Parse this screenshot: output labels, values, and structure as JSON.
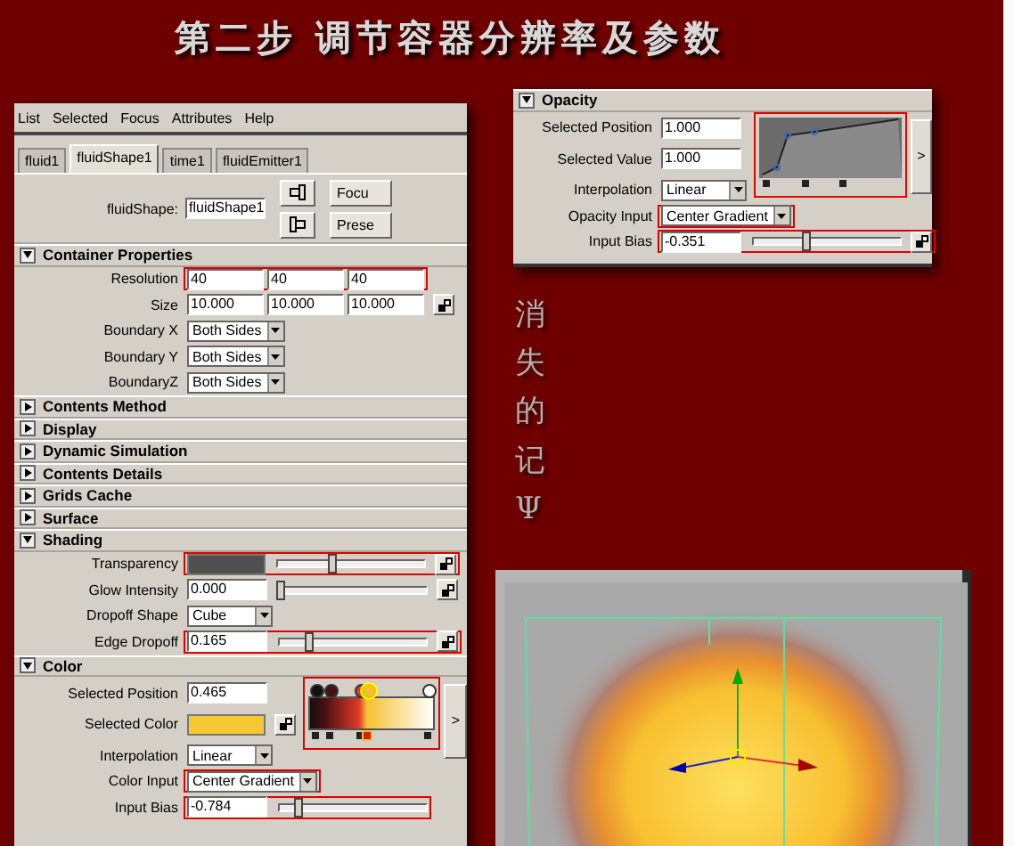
{
  "title": "第二步 调节容器分辨率及参数",
  "side_text": "消失的记Ψ",
  "attribute_editor": {
    "menu": [
      "List",
      "Selected",
      "Focus",
      "Attributes",
      "Help"
    ],
    "tabs": [
      {
        "label": "fluid1",
        "selected": false
      },
      {
        "label": "fluidShape1",
        "selected": true
      },
      {
        "label": "time1",
        "selected": false
      },
      {
        "label": "fluidEmitter1",
        "selected": false
      }
    ],
    "node": {
      "label": "fluidShape:",
      "value": "fluidShape1"
    },
    "buttons": [
      "Focu",
      "Prese"
    ],
    "sections": [
      {
        "title": "Container Properties",
        "expanded": true,
        "rows": [
          {
            "kind": "triple",
            "label": "Resolution",
            "values": [
              "40",
              "40",
              "40"
            ],
            "map_button": false,
            "highlighted": true
          },
          {
            "kind": "triple",
            "label": "Size",
            "values": [
              "10.000",
              "10.000",
              "10.000"
            ],
            "map_button": true,
            "highlighted": false
          },
          {
            "kind": "dropdown",
            "label": "Boundary X",
            "value": "Both Sides",
            "highlighted": false
          },
          {
            "kind": "dropdown",
            "label": "Boundary Y",
            "value": "Both Sides",
            "highlighted": false
          },
          {
            "kind": "dropdown",
            "label": "BoundaryZ",
            "value": "Both Sides",
            "highlighted": false
          }
        ]
      },
      {
        "title": "Contents Method",
        "expanded": false
      },
      {
        "title": "Display",
        "expanded": false
      },
      {
        "title": "Dynamic Simulation",
        "expanded": false
      },
      {
        "title": "Contents Details",
        "expanded": false
      },
      {
        "title": "Grids Cache",
        "expanded": false
      },
      {
        "title": "Surface",
        "expanded": false
      },
      {
        "title": "Shading",
        "expanded": true,
        "rows": [
          {
            "kind": "slider",
            "label": "Transparency",
            "color": "#505050",
            "level": 0.36,
            "map_button": true,
            "highlighted": true
          },
          {
            "kind": "slider",
            "label": "Glow Intensity",
            "value": "0.000",
            "level": 0,
            "map_button": true,
            "highlighted": false
          },
          {
            "kind": "dropdown",
            "label": "Dropoff Shape",
            "value": "Cube",
            "highlighted": false
          },
          {
            "kind": "slider",
            "label": "Edge Dropoff",
            "value": "0.165",
            "level": 0.2,
            "map_button": true,
            "highlighted": true
          }
        ]
      },
      {
        "title": "Color",
        "expanded": true,
        "ramp": {
          "kind": "gradient",
          "highlighted": true,
          "button": ">",
          "fields": [
            {
              "kind": "text",
              "label": "Selected Position",
              "value": "0.465",
              "highlighted": false
            },
            {
              "kind": "swatch",
              "label": "Selected Color",
              "color": "#f8c832",
              "highlighted": false
            },
            {
              "kind": "dropdown",
              "label": "Interpolation",
              "value": "Linear",
              "highlighted": false
            }
          ],
          "markers": [
            {
              "color": "#111111",
              "level": 0,
              "selected": false
            },
            {
              "color": "#4a1010",
              "level": 0.12,
              "selected": false
            },
            {
              "color": "#e03a28",
              "level": 0.4,
              "selected": false
            },
            {
              "color": "#f5c030",
              "level": 0.46,
              "selected": true
            },
            {
              "color": "#ffffff",
              "level": 1,
              "selected": false
            }
          ]
        },
        "rows": [
          {
            "kind": "dropdown",
            "label": "Color Input",
            "value": "Center Gradient",
            "highlighted": true
          },
          {
            "kind": "slider",
            "label": "Input Bias",
            "value": "-0.784",
            "level": 0.12,
            "map_button": false,
            "highlighted": true
          }
        ]
      }
    ]
  },
  "opacity_panel": {
    "title": "Opacity",
    "expanded": true,
    "ramp": {
      "kind": "curve",
      "highlighted": true,
      "button": ">",
      "fields": [
        {
          "kind": "text",
          "label": "Selected Position",
          "value": "1.000",
          "highlighted": false
        },
        {
          "kind": "text",
          "label": "Selected Value",
          "value": "1.000",
          "highlighted": false
        },
        {
          "kind": "dropdown",
          "label": "Interpolation",
          "value": "Linear",
          "highlighted": false
        }
      ]
    },
    "rows": [
      {
        "kind": "dropdown",
        "label": "Opacity Input",
        "value": "Center Gradient",
        "highlighted": true
      },
      {
        "kind": "slider",
        "label": "Input Bias",
        "value": "-0.351",
        "level": 0.35,
        "map_button": true,
        "highlighted": true
      }
    ]
  }
}
